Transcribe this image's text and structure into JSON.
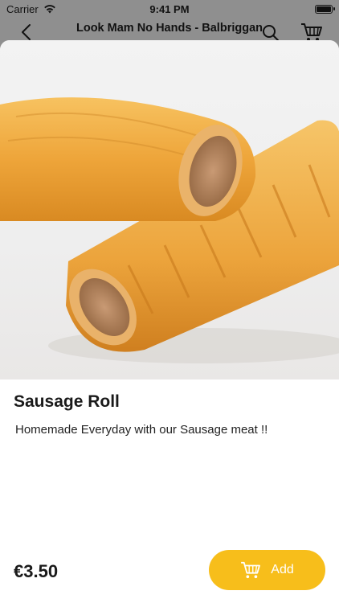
{
  "status_bar": {
    "carrier": "Carrier",
    "time": "9:41 PM"
  },
  "header": {
    "title": "Look Mam No Hands - Balbriggan"
  },
  "product": {
    "name": "Sausage Roll",
    "description": "Homemade Everyday with our Sausage meat !!",
    "price": "€3.50",
    "add_label": "Add"
  },
  "colors": {
    "accent": "#f7be1b",
    "overlay": "#8f8f8f"
  },
  "icons": [
    "wifi-icon",
    "battery-icon",
    "back-chevron-icon",
    "search-icon",
    "cart-icon"
  ]
}
